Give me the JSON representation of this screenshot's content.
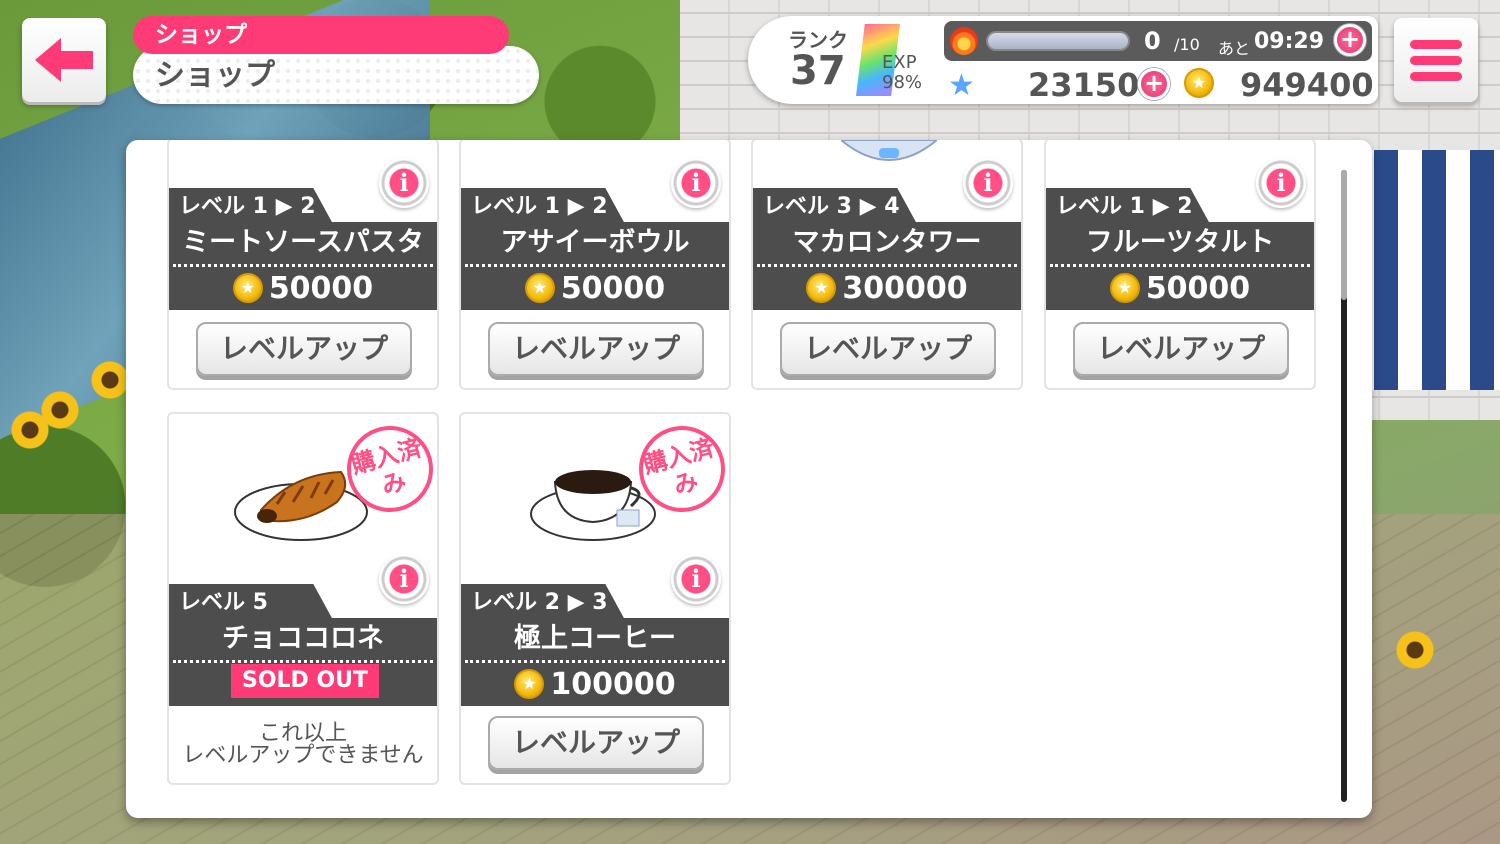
{
  "header": {
    "category_tag": "ショップ",
    "title": "ショップ"
  },
  "status": {
    "rank_label": "ランク",
    "rank_value": "37",
    "exp_label": "EXP",
    "exp_percent": "98%",
    "stamina_current": "0",
    "stamina_max": "/10",
    "timer_label": "あと",
    "timer_value": "09:29",
    "star_gems": "23150",
    "coins": "949400",
    "plus_symbol": "+"
  },
  "shop": {
    "row1": [
      {
        "level": "レベル 1 ▶ 2",
        "name": "ミートソースパスタ",
        "price": "50000",
        "button": "レベルアップ"
      },
      {
        "level": "レベル 1 ▶ 2",
        "name": "アサイーボウル",
        "price": "50000",
        "button": "レベルアップ"
      },
      {
        "level": "レベル 3 ▶ 4",
        "name": "マカロンタワー",
        "price": "300000",
        "button": "レベルアップ"
      },
      {
        "level": "レベル 1 ▶ 2",
        "name": "フルーツタルト",
        "price": "50000",
        "button": "レベルアップ"
      }
    ],
    "row2": [
      {
        "level": "レベル 5",
        "name": "チョココロネ",
        "badge": "SOLD OUT",
        "stamp": "購入済み",
        "note_line1": "これ以上",
        "note_line2": "レベルアップできません"
      },
      {
        "level": "レベル 2 ▶ 3",
        "name": "極上コーヒー",
        "price": "100000",
        "stamp": "購入済み",
        "button": "レベルアップ"
      }
    ],
    "info_symbol": "i"
  },
  "icons": {
    "back": "back-arrow-icon",
    "menu": "hamburger-menu-icon",
    "coin": "coin-icon",
    "info": "info-icon",
    "stamina": "fire-icon",
    "gem": "star-icon"
  },
  "colors": {
    "accent": "#ff3b77",
    "band": "#4d4d4d",
    "coin": "#f3b90c"
  }
}
